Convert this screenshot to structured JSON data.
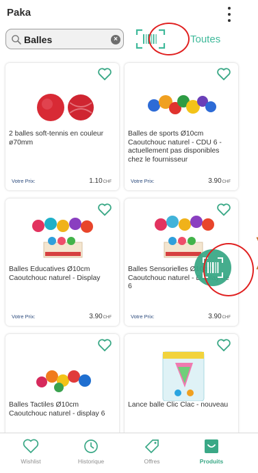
{
  "header": {
    "title": "Paka"
  },
  "search": {
    "value": "Balles",
    "filter_label": "Toutes"
  },
  "products": [
    {
      "name": "2 balles soft-tennis en couleur ø70mm",
      "price_label": "Votre Prix:",
      "price": "1.10",
      "currency": "CHF"
    },
    {
      "name": "Balles de sports Ø10cm Caoutchouc naturel - CDU 6 - actuellement pas disponibles chez le fournisseur",
      "price_label": "Votre Prix:",
      "price": "3.90",
      "currency": "CHF"
    },
    {
      "name": "Balles Educatives Ø10cm Caoutchouc naturel - Display",
      "price_label": "Votre Prix:",
      "price": "3.90",
      "currency": "CHF"
    },
    {
      "name": "Balles Sensorielles Ø10cm Caoutchouc naturel - Display de 6",
      "price_label": "Votre Prix:",
      "price": "3.90",
      "currency": "CHF"
    },
    {
      "name": "Balles Tactiles Ø10cm Caoutchouc naturel -  display 6",
      "price_label": "",
      "price": "",
      "currency": ""
    },
    {
      "name": "Lance balle Clic Clac - nouveau",
      "price_label": "",
      "price": "",
      "currency": ""
    }
  ],
  "tabs": [
    {
      "label": "Wishlist",
      "icon": "heart-icon"
    },
    {
      "label": "Historique",
      "icon": "history-icon"
    },
    {
      "label": "Offres",
      "icon": "tag-icon"
    },
    {
      "label": "Produits",
      "icon": "products-icon",
      "active": true
    }
  ],
  "colors": {
    "accent": "#3aa886",
    "annotation": "#e02020"
  }
}
